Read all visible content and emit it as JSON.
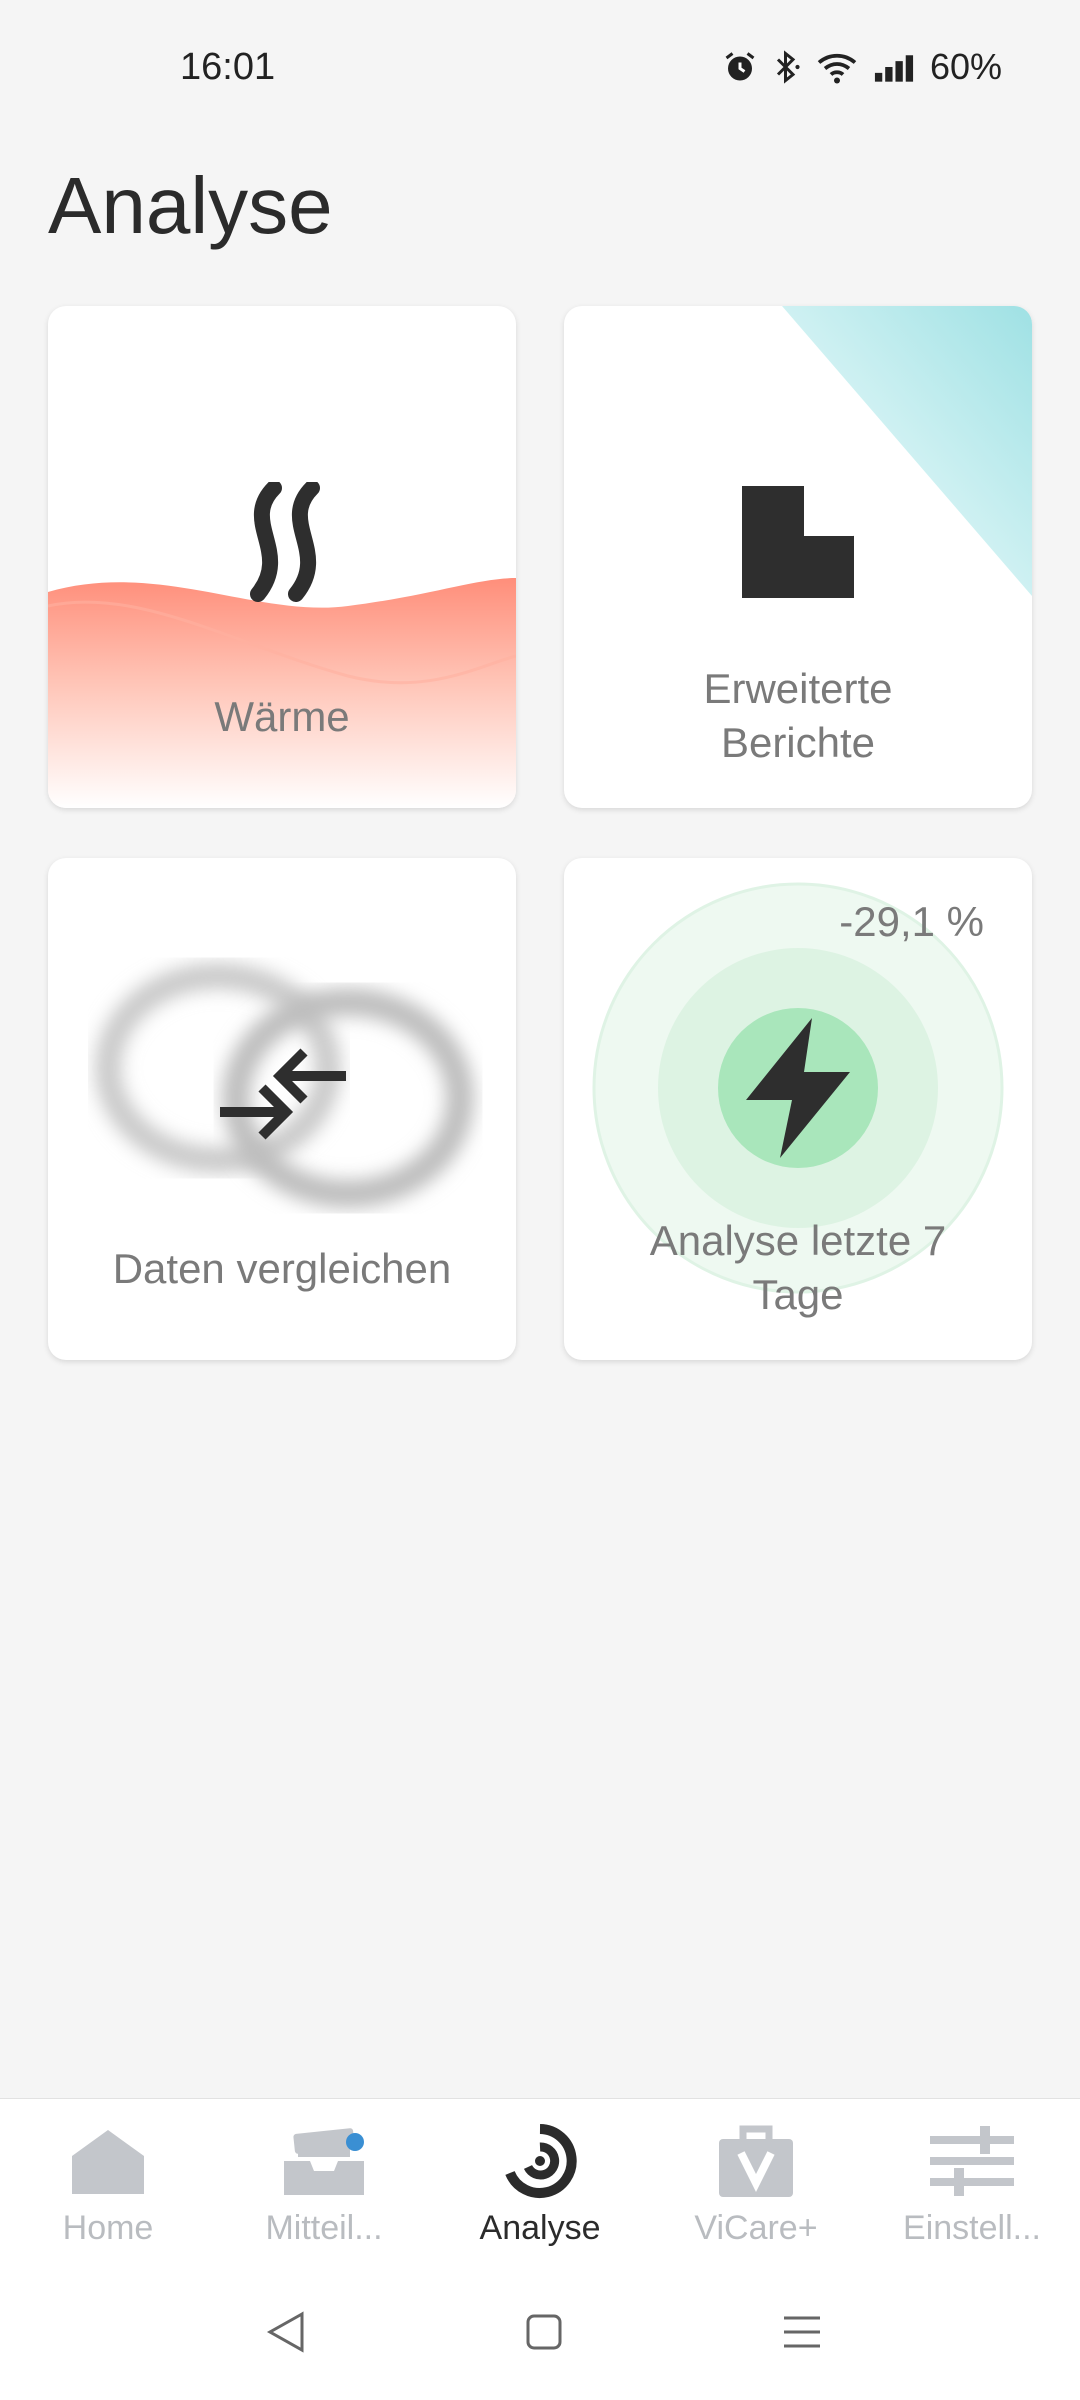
{
  "status_bar": {
    "time": "16:01",
    "battery": "60%"
  },
  "page": {
    "title": "Analyse"
  },
  "cards": {
    "heat": {
      "label": "Wärme",
      "icon": "heat-waves-icon",
      "accent": "#ff9a86"
    },
    "reports": {
      "label_line1": "Erweiterte",
      "label_line2": "Berichte",
      "icon": "report-document-icon",
      "accent": "#9fe1e4"
    },
    "compare": {
      "label": "Daten vergleichen",
      "icon": "compare-arrows-icon"
    },
    "last7": {
      "label_line1": "Analyse letzte 7",
      "label_line2": "Tage",
      "change": "-29,1 %",
      "icon": "lightning-icon",
      "accent": "#8fe0a6"
    }
  },
  "bottom_nav": {
    "items": [
      {
        "label": "Home",
        "icon": "home-icon"
      },
      {
        "label": "Mitteil...",
        "icon": "inbox-icon"
      },
      {
        "label": "Analyse",
        "icon": "analysis-icon"
      },
      {
        "label": "ViCare+",
        "icon": "vicare-bag-icon"
      },
      {
        "label": "Einstell...",
        "icon": "sliders-icon"
      }
    ],
    "active_index": 2
  },
  "system_nav": {
    "icons": [
      "back-icon",
      "home-square-icon",
      "menu-icon"
    ]
  }
}
